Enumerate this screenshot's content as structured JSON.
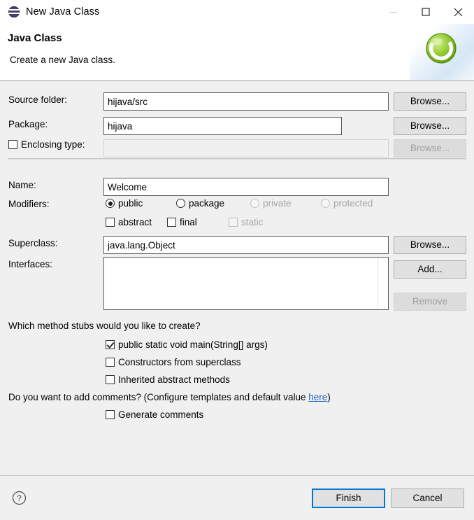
{
  "window": {
    "title": "New Java Class",
    "icon": "eclipse-icon",
    "controls": {
      "minimize": "minimize-button",
      "maximize": "maximize-button",
      "close": "close-button"
    }
  },
  "header": {
    "title": "Java Class",
    "description": "Create a new Java class.",
    "logo": "java-class-wizard-icon"
  },
  "form": {
    "source_folder": {
      "label": "Source folder:",
      "value": "hijava/src",
      "browse_label": "Browse..."
    },
    "package": {
      "label": "Package:",
      "value": "hijava",
      "browse_label": "Browse..."
    },
    "enclosing_type": {
      "label": "Enclosing type:",
      "value": "",
      "checked": false,
      "enabled": false,
      "browse_label": "Browse..."
    },
    "name": {
      "label": "Name:",
      "value": "Welcome"
    },
    "modifiers": {
      "label": "Modifiers:",
      "access": [
        {
          "label": "public",
          "selected": true,
          "enabled": true
        },
        {
          "label": "package",
          "selected": false,
          "enabled": true
        },
        {
          "label": "private",
          "selected": false,
          "enabled": false
        },
        {
          "label": "protected",
          "selected": false,
          "enabled": false
        }
      ],
      "flags": [
        {
          "label": "abstract",
          "checked": false,
          "enabled": true
        },
        {
          "label": "final",
          "checked": false,
          "enabled": true
        },
        {
          "label": "static",
          "checked": false,
          "enabled": false
        }
      ]
    },
    "superclass": {
      "label": "Superclass:",
      "value": "java.lang.Object",
      "browse_label": "Browse..."
    },
    "interfaces": {
      "label": "Interfaces:",
      "items": [],
      "add_label": "Add...",
      "remove_label": "Remove",
      "remove_enabled": false
    }
  },
  "stubs": {
    "question": "Which method stubs would you like to create?",
    "options": [
      {
        "label": "public static void main(String[] args)",
        "checked": true
      },
      {
        "label": "Constructors from superclass",
        "checked": false
      },
      {
        "label": "Inherited abstract methods",
        "checked": false
      }
    ]
  },
  "comments": {
    "question_prefix": "Do you want to add comments? (Configure templates and default value ",
    "link_text": "here",
    "question_suffix": ")",
    "option": {
      "label": "Generate comments",
      "checked": false
    }
  },
  "footer": {
    "help": "help-icon",
    "finish_label": "Finish",
    "cancel_label": "Cancel"
  },
  "colors": {
    "accent": "#0078d7",
    "link": "#1c64c8",
    "body_bg": "#f0f0f0",
    "header_bg": "#ffffff",
    "logo_green": "#7ac23c"
  }
}
